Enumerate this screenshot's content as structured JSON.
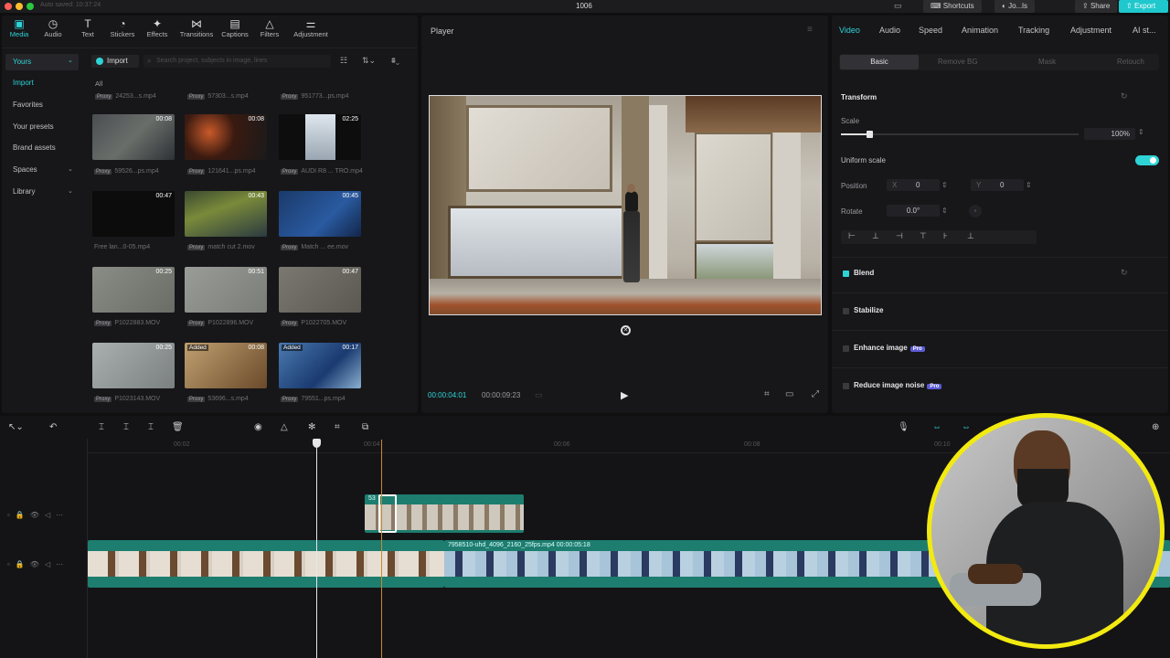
{
  "titlebar": {
    "autosave": "Auto saved: 10:37:24",
    "project_name": "1006",
    "shortcuts": "Shortcuts",
    "user": "Jo...ls",
    "share": "Share",
    "export": "Export"
  },
  "toolbar": {
    "tools": [
      "Media",
      "Audio",
      "Text",
      "Stickers",
      "Effects",
      "Transitions",
      "Captions",
      "Filters",
      "Adjustment"
    ]
  },
  "sidebar": {
    "yours": "Yours",
    "import": "Import",
    "favorites": "Favorites",
    "presets": "Your presets",
    "brand": "Brand assets",
    "spaces": "Spaces",
    "library": "Library"
  },
  "media": {
    "import_btn": "Import",
    "search_placeholder": "Search project, subjects in image, lines",
    "all": "All",
    "top_names": [
      "24253...s.mp4",
      "57303...s.mp4",
      "951773...ps.mp4"
    ],
    "items": [
      {
        "dur": "00:08",
        "name": "59526...ps.mp4",
        "tag": ""
      },
      {
        "dur": "00:08",
        "name": "121641...ps.mp4",
        "tag": ""
      },
      {
        "dur": "02:25",
        "name": "AUDI R8 ... TRO.mp4",
        "tag": ""
      },
      {
        "dur": "00:47",
        "name": "Free lan...0-05.mp4",
        "tag": ""
      },
      {
        "dur": "00:43",
        "name": "match cut 2.mov",
        "tag": ""
      },
      {
        "dur": "00:45",
        "name": "Match ... ee.mov",
        "tag": ""
      },
      {
        "dur": "00:25",
        "name": "P1022883.MOV",
        "tag": ""
      },
      {
        "dur": "00:51",
        "name": "P1022896.MOV",
        "tag": ""
      },
      {
        "dur": "00:47",
        "name": "P1022705.MOV",
        "tag": ""
      },
      {
        "dur": "00:25",
        "name": "P1023143.MOV",
        "tag": ""
      },
      {
        "dur": "00:08",
        "name": "53696...s.mp4",
        "tag": "Added"
      },
      {
        "dur": "00:17",
        "name": "79551...ps.mp4",
        "tag": "Added"
      }
    ]
  },
  "player": {
    "title": "Player",
    "current_time": "00:00:04:01",
    "total_time": "00:00:09:23"
  },
  "inspector": {
    "tabs": [
      "Video",
      "Audio",
      "Speed",
      "Animation",
      "Tracking",
      "Adjustment",
      "AI st..."
    ],
    "subtabs": [
      "Basic",
      "Remove BG",
      "Mask",
      "Retouch"
    ],
    "transform": "Transform",
    "scale_label": "Scale",
    "scale_value": "100%",
    "scale_fraction": 0.6,
    "uniform_scale": "Uniform scale",
    "position_label": "Position",
    "pos_x_label": "X",
    "pos_x": "0",
    "pos_y_label": "Y",
    "pos_y": "0",
    "rotate_label": "Rotate",
    "rotate_value": "0.0°",
    "blend": "Blend",
    "stabilize": "Stabilize",
    "enhance": "Enhance image",
    "reduce_noise": "Reduce image noise",
    "pro": "Pro",
    "accent": "#2fd3d6"
  },
  "timeline": {
    "ruler": [
      "00:00",
      "00:02",
      "00:04",
      "00:06",
      "00:08",
      "00:10"
    ],
    "clip_label": "7958510-uhd_4096_2160_25fps.mp4",
    "clip_duration": "00:00:05:18",
    "overlay_clip_label": "53"
  }
}
